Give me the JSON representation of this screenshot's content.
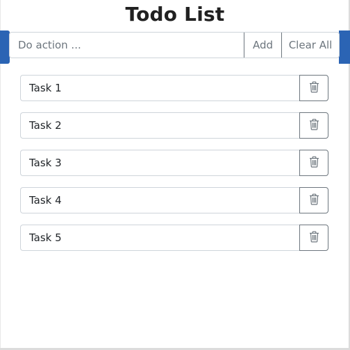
{
  "header": {
    "title": "Todo List"
  },
  "form": {
    "placeholder": "Do action ...",
    "value": "",
    "add_label": "Add",
    "clear_label": "Clear All"
  },
  "tasks": [
    {
      "label": "Task 1"
    },
    {
      "label": "Task 2"
    },
    {
      "label": "Task 3"
    },
    {
      "label": "Task 4"
    },
    {
      "label": "Task 5"
    }
  ],
  "icons": {
    "delete": "trash-icon"
  },
  "colors": {
    "accent": "#2b64b4",
    "button_outline": "#6c757d",
    "input_border": "#ced4da",
    "title_text": "#212121"
  }
}
